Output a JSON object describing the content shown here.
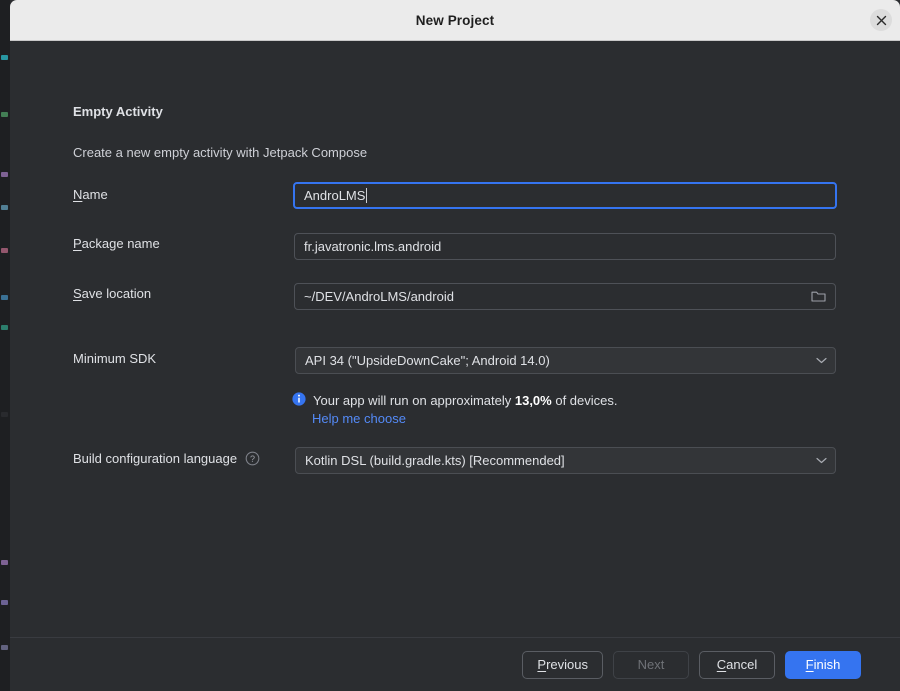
{
  "window": {
    "title": "New Project",
    "close_icon": "close-icon"
  },
  "content": {
    "section_title": "Empty Activity",
    "section_description": "Create a new empty activity with Jetpack Compose",
    "fields": {
      "name": {
        "label_prefix": "",
        "label_mnemonic": "N",
        "label_suffix": "ame",
        "value": "AndroLMS",
        "focused": true
      },
      "package_name": {
        "label_prefix": "",
        "label_mnemonic": "P",
        "label_suffix": "ackage name",
        "value": "fr.javatronic.lms.android"
      },
      "save_location": {
        "label_prefix": "",
        "label_mnemonic": "S",
        "label_suffix": "ave location",
        "value": "~/DEV/AndroLMS/android",
        "browse_icon": "folder-icon"
      },
      "minimum_sdk": {
        "label": "Minimum SDK",
        "value": "API 34 (\"UpsideDownCake\"; Android 14.0)",
        "chevron_icon": "chevron-down-icon"
      },
      "build_config_language": {
        "label": "Build configuration language",
        "help_icon": "help-circle-icon",
        "value": "Kotlin DSL (build.gradle.kts) [Recommended]",
        "chevron_icon": "chevron-down-icon"
      }
    },
    "sdk_info": {
      "icon": "info-icon",
      "text_before": "Your app will run on approximately ",
      "percentage": "13,0%",
      "text_after": " of devices.",
      "help_link": "Help me choose"
    }
  },
  "buttons": {
    "previous": {
      "prefix": "",
      "mnemonic": "P",
      "suffix": "revious"
    },
    "next": {
      "label": "Next",
      "disabled": true
    },
    "cancel": {
      "prefix": "",
      "mnemonic": "C",
      "suffix": "ancel"
    },
    "finish": {
      "prefix": "",
      "mnemonic": "F",
      "suffix": "inish"
    }
  },
  "colors": {
    "dialog_background": "#2b2d30",
    "titlebar_background": "#ebebeb",
    "accent_blue": "#3574f0",
    "link_blue": "#548af7",
    "field_border": "#4e5157",
    "text_primary": "#dfe1e5"
  }
}
